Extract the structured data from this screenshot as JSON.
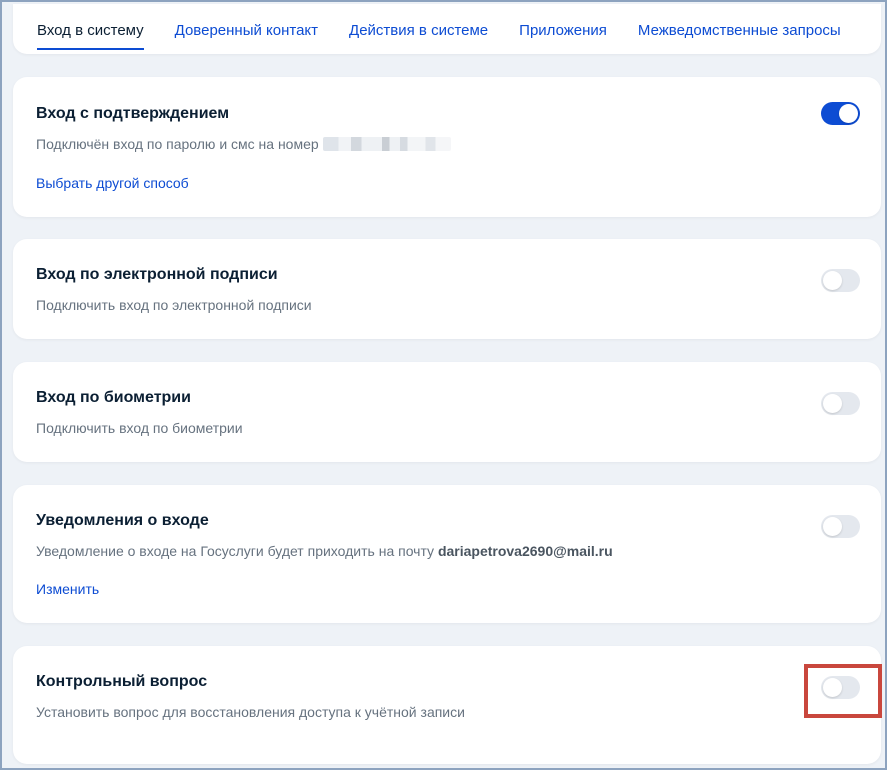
{
  "tabs": [
    {
      "label": "Вход в систему",
      "active": true
    },
    {
      "label": "Доверенный контакт"
    },
    {
      "label": "Действия в системе"
    },
    {
      "label": "Приложения"
    },
    {
      "label": "Межведомственные запросы"
    }
  ],
  "cards": {
    "confirm": {
      "title": "Вход с подтверждением",
      "desc": "Подключён вход по паролю и смс на номер",
      "link": "Выбрать другой способ",
      "toggle_on": true
    },
    "esign": {
      "title": "Вход по электронной подписи",
      "desc": "Подключить вход по электронной подписи",
      "toggle_on": false
    },
    "biometry": {
      "title": "Вход по биометрии",
      "desc": "Подключить вход по биометрии",
      "toggle_on": false
    },
    "notify": {
      "title": "Уведомления о входе",
      "desc": "Уведомление о входе на Госуслуги будет приходить на почту",
      "email": "dariapetrova2690@mail.ru",
      "link": "Изменить",
      "toggle_on": false
    },
    "question": {
      "title": "Контрольный вопрос",
      "desc": "Установить вопрос для восстановления доступа к учётной записи",
      "toggle_on": false
    }
  },
  "colors": {
    "accent": "#0d4cd3",
    "highlight": "#c9473d"
  }
}
